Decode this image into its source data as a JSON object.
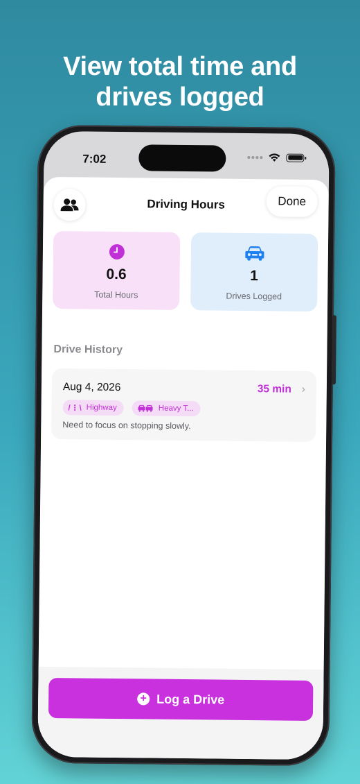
{
  "headline": {
    "line1": "View total time and",
    "line2": "drives logged"
  },
  "status_bar": {
    "time": "7:02"
  },
  "nav": {
    "title": "Driving Hours",
    "done_label": "Done",
    "left_icon": "people-icon"
  },
  "stats": [
    {
      "value": "0.6",
      "label": "Total Hours",
      "icon": "clock-icon",
      "color": "#c12fd6"
    },
    {
      "value": "1",
      "label": "Drives Logged",
      "icon": "car-icon",
      "color": "#1e7ff0"
    }
  ],
  "history": {
    "section_title": "Drive History",
    "drives": [
      {
        "date": "Aug 4, 2026",
        "duration": "35 min",
        "tags": [
          {
            "icon_text": "/⋮\\",
            "label": "Highway"
          },
          {
            "icon_text": "🚗🚗",
            "label": "Heavy T..."
          }
        ],
        "note": "Need to focus on stopping slowly."
      }
    ]
  },
  "primary_action": {
    "label": "Log a Drive"
  },
  "colors": {
    "accent": "#c930de",
    "pink_card": "#f8e1f8",
    "blue_card": "#e0eefb",
    "blue_icon": "#1e7ff0"
  }
}
